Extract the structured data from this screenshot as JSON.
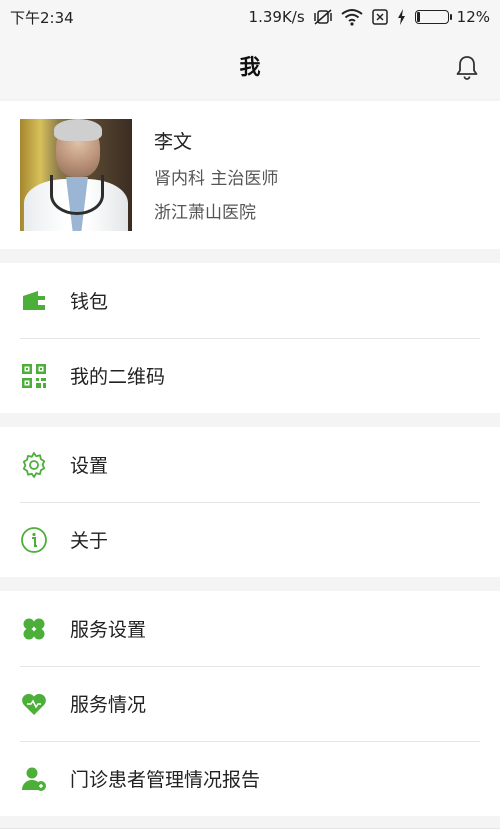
{
  "status": {
    "time": "下午2:34",
    "speed": "1.39K/s",
    "battery": "12%",
    "battery_level": 0.12
  },
  "header": {
    "title": "我"
  },
  "profile": {
    "name": "李文",
    "department_title": "肾内科 主治医师",
    "hospital": "浙江萧山医院"
  },
  "groups": [
    {
      "items": [
        {
          "label": "钱包",
          "icon": "wallet-icon"
        },
        {
          "label": "我的二维码",
          "icon": "qr-code-icon"
        }
      ]
    },
    {
      "items": [
        {
          "label": "设置",
          "icon": "gear-icon"
        },
        {
          "label": "关于",
          "icon": "info-icon"
        }
      ]
    },
    {
      "items": [
        {
          "label": "服务设置",
          "icon": "clover-icon"
        },
        {
          "label": "服务情况",
          "icon": "heart-icon"
        },
        {
          "label": "门诊患者管理情况报告",
          "icon": "patient-report-icon"
        }
      ]
    }
  ],
  "colors": {
    "accent": "#4caf3a",
    "background": "#f4f4f4"
  }
}
